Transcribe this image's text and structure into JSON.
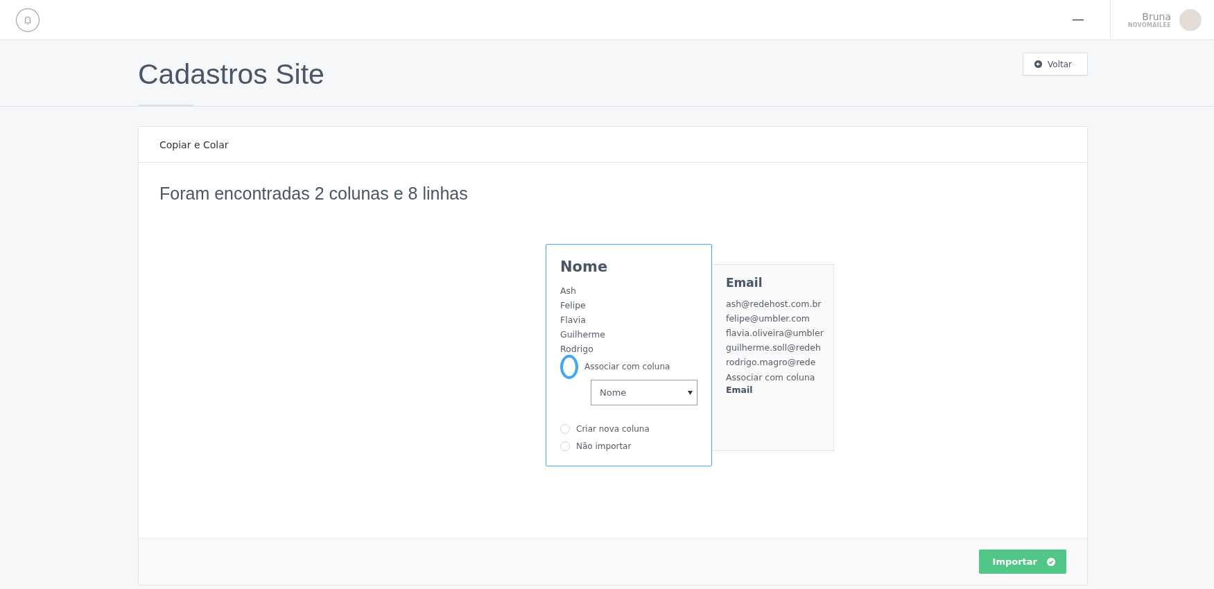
{
  "topbar": {
    "user": {
      "name": "Bruna",
      "account": "NOVOMAILEE"
    }
  },
  "page": {
    "title": "Cadastros Site",
    "back_button": "Voltar"
  },
  "panel": {
    "title": "Copiar e Colar",
    "summary": "Foram encontradas 2 colunas e 8 linhas",
    "columns": [
      {
        "title": "Nome",
        "selected": true,
        "values": [
          "Ash",
          "Felipe",
          "Flavia",
          "Guilherme",
          "Rodrigo"
        ],
        "options": [
          {
            "kind": "select",
            "label": "Associar com coluna",
            "selected": true,
            "value": "Nome"
          },
          {
            "kind": "plain",
            "label": "Criar nova coluna",
            "selected": false
          },
          {
            "kind": "plain",
            "label": "Não importar",
            "selected": false
          }
        ]
      },
      {
        "title": "Email",
        "selected": false,
        "values": [
          "ash@redehost.com.br",
          "felipe@umbler.com",
          "flavia.oliveira@umbler",
          "guilherme.soll@redeh",
          "rodrigo.magro@rede"
        ],
        "association": "Associar com coluna",
        "association_column": "Email"
      }
    ],
    "import_button": "Importar"
  }
}
